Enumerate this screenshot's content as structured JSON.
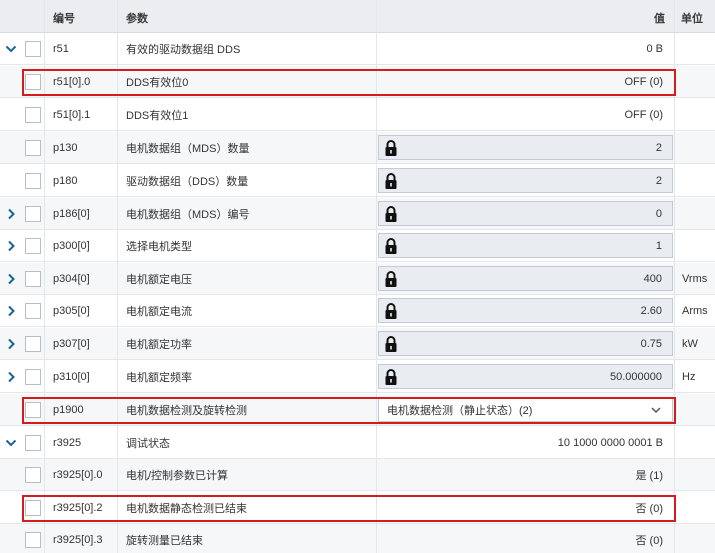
{
  "columns": {
    "number": "编号",
    "param": "参数",
    "value": "值",
    "unit": "单位"
  },
  "rows": [
    {
      "expander": "expanded",
      "number": "r51",
      "param": "有效的驱动数据组 DDS",
      "value": "0 B",
      "kind": "text",
      "unit": ""
    },
    {
      "expander": "",
      "number": "r51[0].0",
      "param": "DDS有效位0",
      "value": "OFF (0)",
      "kind": "text",
      "unit": ""
    },
    {
      "expander": "",
      "number": "r51[0].1",
      "param": "DDS有效位1",
      "value": "OFF (0)",
      "kind": "text",
      "unit": ""
    },
    {
      "expander": "",
      "number": "p130",
      "param": "电机数据组（MDS）数量",
      "value": "2",
      "kind": "locked",
      "unit": ""
    },
    {
      "expander": "",
      "number": "p180",
      "param": "驱动数据组（DDS）数量",
      "value": "2",
      "kind": "locked",
      "unit": ""
    },
    {
      "expander": "collapsed",
      "number": "p186[0]",
      "param": "电机数据组（MDS）编号",
      "value": "0",
      "kind": "locked",
      "unit": ""
    },
    {
      "expander": "collapsed",
      "number": "p300[0]",
      "param": "选择电机类型",
      "value": "1",
      "kind": "locked",
      "unit": ""
    },
    {
      "expander": "collapsed",
      "number": "p304[0]",
      "param": "电机额定电压",
      "value": "400",
      "kind": "locked",
      "unit": "Vrms"
    },
    {
      "expander": "collapsed",
      "number": "p305[0]",
      "param": "电机额定电流",
      "value": "2.60",
      "kind": "locked",
      "unit": "Arms"
    },
    {
      "expander": "collapsed",
      "number": "p307[0]",
      "param": "电机额定功率",
      "value": "0.75",
      "kind": "locked",
      "unit": "kW"
    },
    {
      "expander": "collapsed",
      "number": "p310[0]",
      "param": "电机额定频率",
      "value": "50.000000",
      "kind": "locked",
      "unit": "Hz"
    },
    {
      "expander": "",
      "number": "p1900",
      "param": "电机数据检测及旋转检测",
      "value": "电机数据检测（静止状态）(2)",
      "kind": "dropdown",
      "unit": ""
    },
    {
      "expander": "expanded",
      "number": "r3925",
      "param": "调试状态",
      "value": "10 1000 0000 0001 B",
      "kind": "text",
      "unit": ""
    },
    {
      "expander": "",
      "number": "r3925[0].0",
      "param": "电机/控制参数已计算",
      "value": "是 (1)",
      "kind": "text",
      "unit": ""
    },
    {
      "expander": "",
      "number": "r3925[0].2",
      "param": "电机数据静态检测已结束",
      "value": "否 (0)",
      "kind": "text",
      "unit": ""
    },
    {
      "expander": "",
      "number": "r3925[0].3",
      "param": "旋转测量已结束",
      "value": "否 (0)",
      "kind": "text",
      "unit": ""
    }
  ],
  "highlighted_rows": [
    "r51[0].0",
    "p1900",
    "r3925[0].2"
  ],
  "colors": {
    "highlight": "#d41c1c",
    "accent": "#1a6496"
  }
}
